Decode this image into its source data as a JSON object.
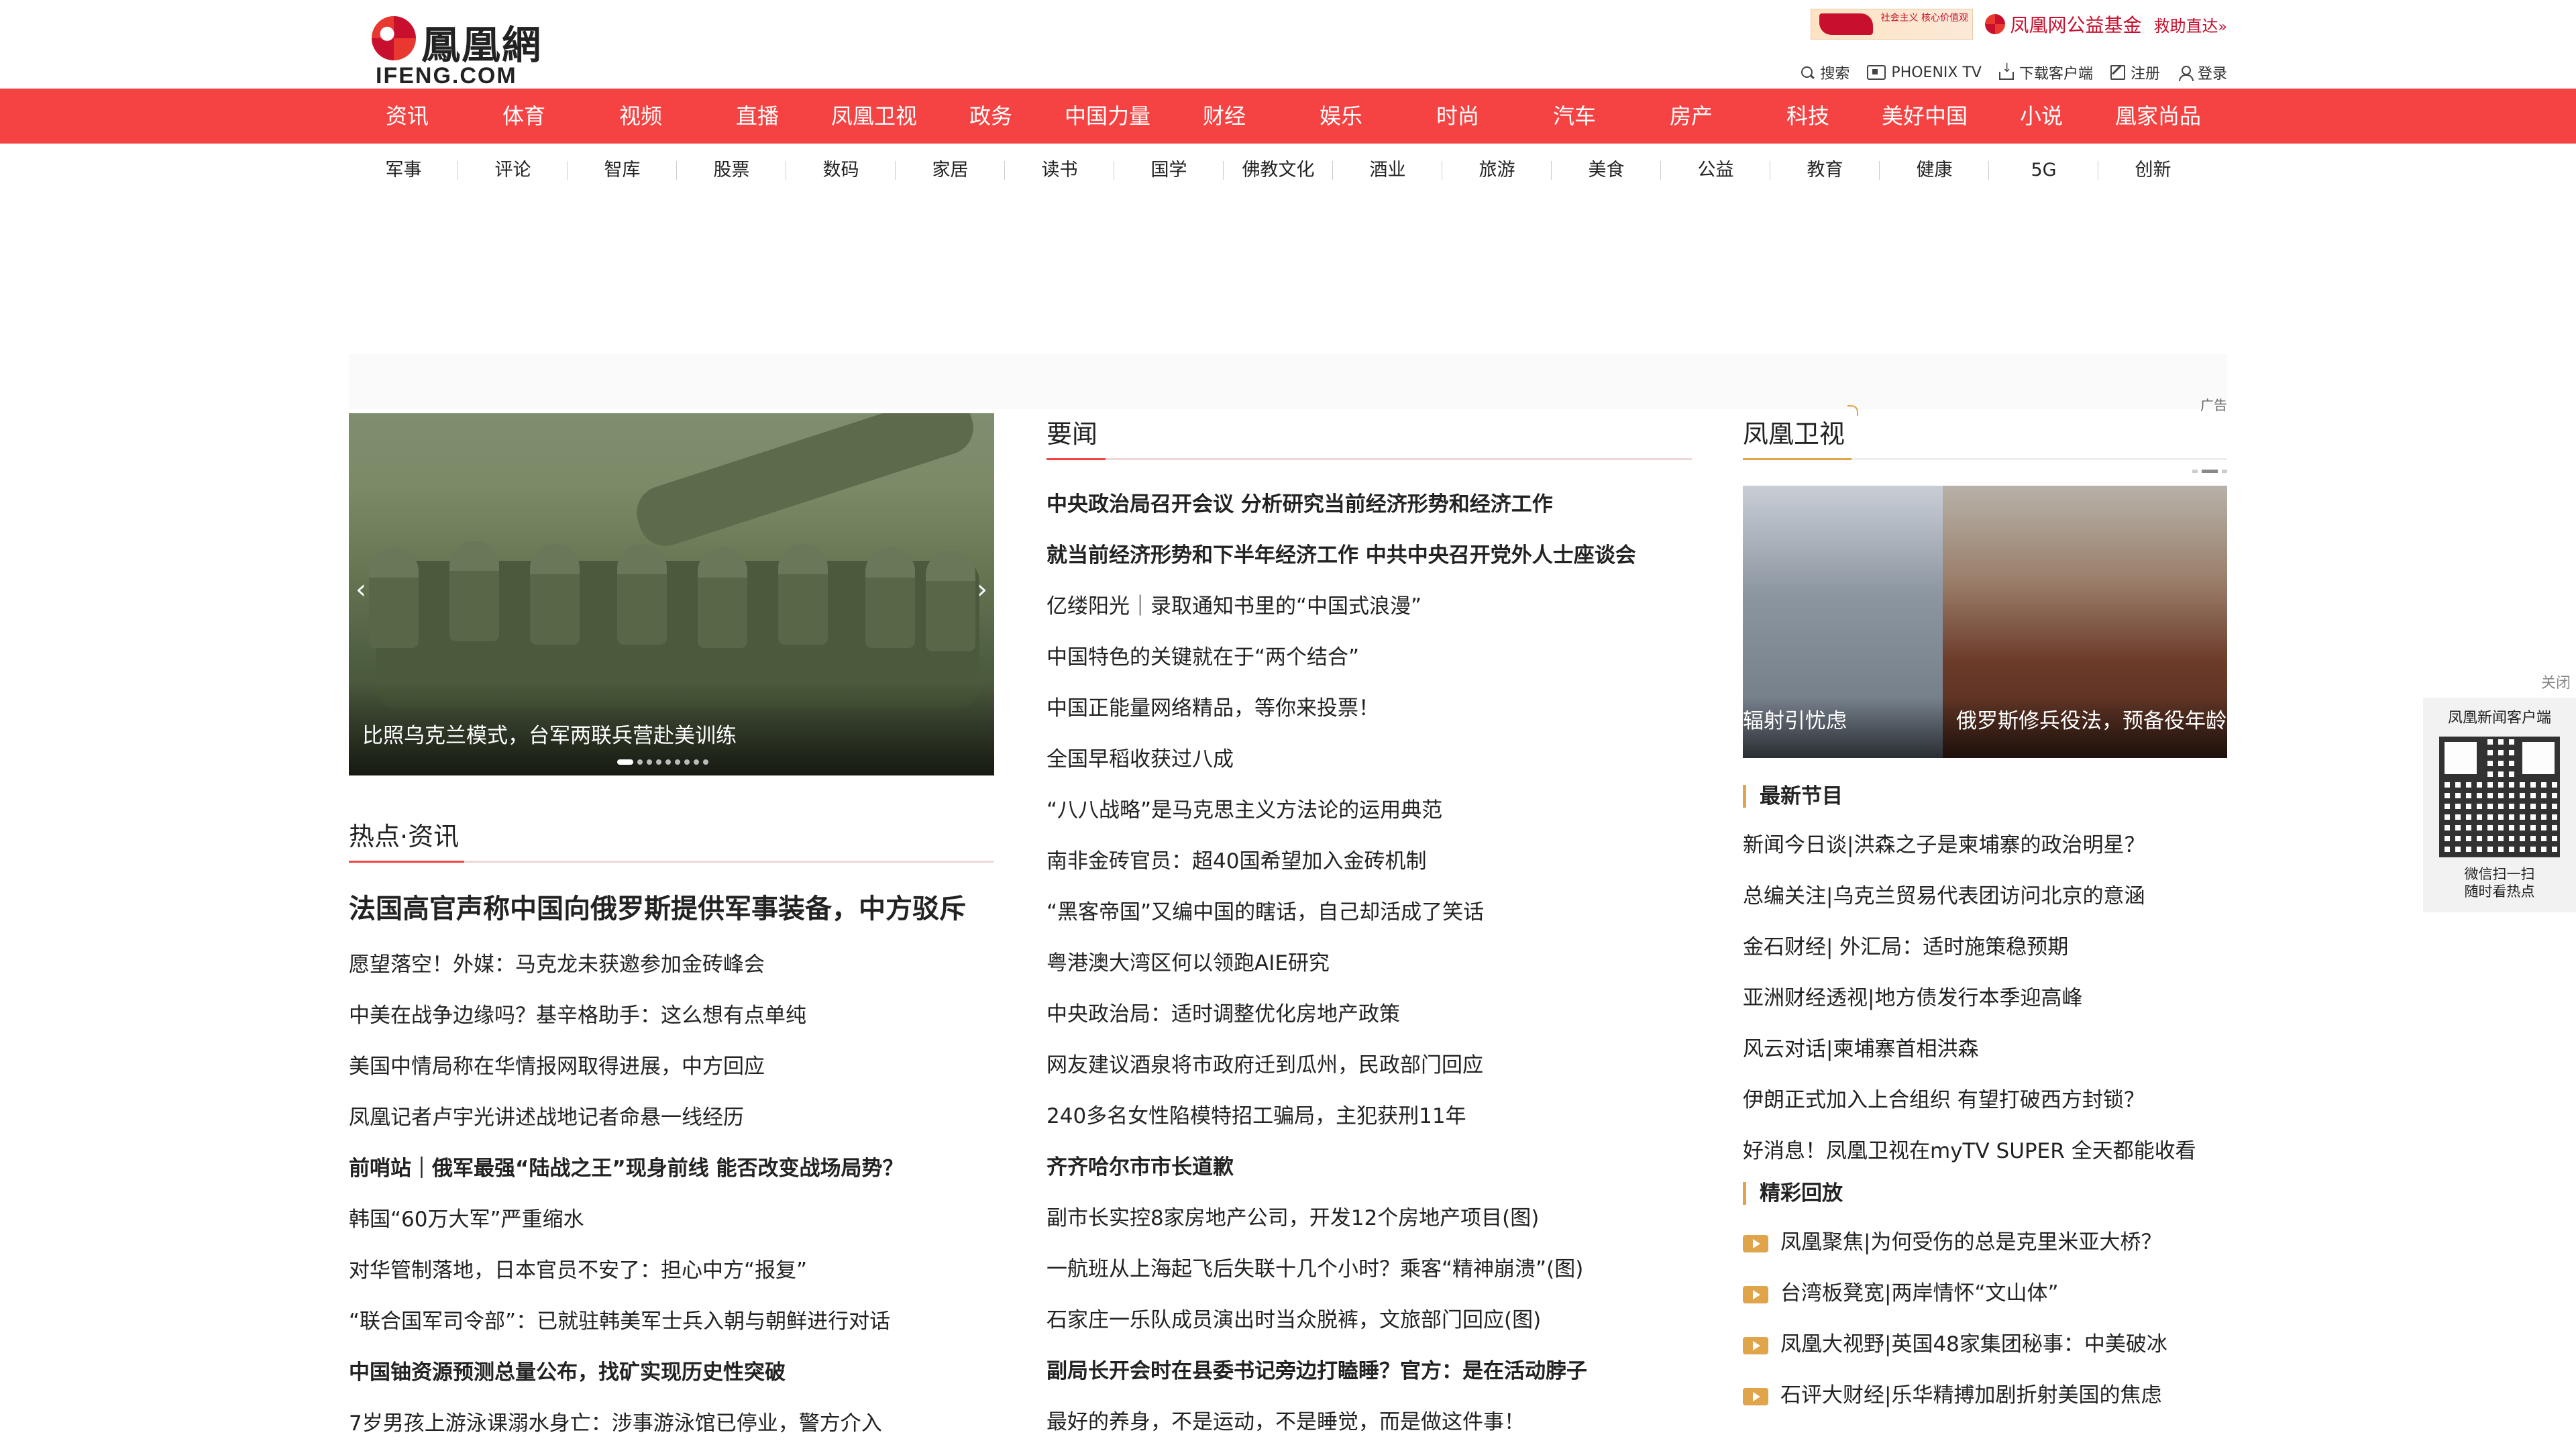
{
  "logo": {
    "cn": "鳳凰網",
    "en": "IFENG.COM"
  },
  "header": {
    "promo_text": "社会主义 核心价值观",
    "charity": "凤凰网公益基金",
    "rescue": "救助直达",
    "tools": [
      {
        "icon": "search-icon",
        "label": "搜索"
      },
      {
        "icon": "tv-icon",
        "label": "PHOENIX TV"
      },
      {
        "icon": "download-icon",
        "label": "下载客户端"
      },
      {
        "icon": "register-icon",
        "label": "注册"
      },
      {
        "icon": "user-icon",
        "label": "登录"
      }
    ]
  },
  "mainnav": [
    "资讯",
    "体育",
    "视频",
    "直播",
    "凤凰卫视",
    "政务",
    "中国力量",
    "财经",
    "娱乐",
    "时尚",
    "汽车",
    "房产",
    "科技",
    "美好中国",
    "小说",
    "凰家尚品"
  ],
  "subnav": [
    "军事",
    "评论",
    "智库",
    "股票",
    "数码",
    "家居",
    "读书",
    "国学",
    "佛教文化",
    "酒业",
    "旅游",
    "美食",
    "公益",
    "教育",
    "健康",
    "5G",
    "创新"
  ],
  "ad": {
    "label": "广告"
  },
  "slider": {
    "caption": "比照乌克兰模式，台军两联兵营赴美训练",
    "prev": "‹",
    "next": "›"
  },
  "hot": {
    "title": "热点·资讯",
    "lead": "法国高官声称中国向俄罗斯提供军事装备，中方驳斥",
    "items": [
      {
        "text": "愿望落空！外媒：马克龙未获邀参加金砖峰会",
        "bold": false
      },
      {
        "text": "中美在战争边缘吗？基辛格助手：这么想有点单纯",
        "bold": false
      },
      {
        "text": "美国中情局称在华情报网取得进展，中方回应",
        "bold": false
      },
      {
        "text": "凤凰记者卢宇光讲述战地记者命悬一线经历",
        "bold": false
      },
      {
        "text": "前哨站｜俄军最强“陆战之王”现身前线 能否改变战场局势？",
        "bold": true
      },
      {
        "text": "韩国“60万大军”严重缩水",
        "bold": false
      },
      {
        "text": "对华管制落地，日本官员不安了：担心中方“报复”",
        "bold": false
      },
      {
        "text": "“联合国军司令部”：已就驻韩美军士兵入朝与朝鲜进行对话",
        "bold": false
      },
      {
        "text": "中国铀资源预测总量公布，找矿实现历史性突破",
        "bold": true
      },
      {
        "text": "7岁男孩上游泳课溺水身亡：涉事游泳馆已停业，警方介入",
        "bold": false
      }
    ]
  },
  "yaowen": {
    "title": "要闻",
    "items": [
      {
        "text": "中央政治局召开会议 分析研究当前经济形势和经济工作",
        "bold": true
      },
      {
        "text": "就当前经济形势和下半年经济工作 中共中央召开党外人士座谈会",
        "bold": true
      },
      {
        "text": "亿缕阳光｜录取通知书里的“中国式浪漫”",
        "bold": false
      },
      {
        "text": "中国特色的关键就在于“两个结合”",
        "bold": false
      },
      {
        "text": "中国正能量网络精品，等你来投票！",
        "bold": false
      },
      {
        "text": "全国早稻收获过八成",
        "bold": false
      },
      {
        "text": "“八八战略”是马克思主义方法论的运用典范",
        "bold": false
      },
      {
        "text": "南非金砖官员：超40国希望加入金砖机制",
        "bold": false
      },
      {
        "text": "“黑客帝国”又编中国的瞎话，自己却活成了笑话",
        "bold": false
      },
      {
        "text": "粤港澳大湾区何以领跑AIE研究",
        "bold": false
      },
      {
        "text": "中央政治局：适时调整优化房地产政策",
        "bold": false
      },
      {
        "text": "网友建议酒泉将市政府迁到瓜州，民政部门回应",
        "bold": false
      },
      {
        "text": "240多名女性陷模特招工骗局，主犯获刑11年",
        "bold": false
      },
      {
        "text": "齐齐哈尔市市长道歉",
        "bold": true
      },
      {
        "text": "副市长实控8家房地产公司，开发12个房地产项目(图)",
        "bold": false
      },
      {
        "text": "一航班从上海起飞后失联十几个小时？乘客“精神崩溃”(图)",
        "bold": false
      },
      {
        "text": "石家庄一乐队成员演出时当众脱裤，文旅部门回应(图)",
        "bold": false
      },
      {
        "text": "副局长开会时在县委书记旁边打瞌睡？官方：是在活动脖子",
        "bold": true
      },
      {
        "text": "最好的养身，不是运动，不是睡觉，而是做这件事！",
        "bold": false
      }
    ]
  },
  "phoenixtv": {
    "title": "凤凰卫视",
    "cards": [
      {
        "caption": "辐射引忧虑"
      },
      {
        "caption": "俄罗斯修兵役法，预备役年龄"
      }
    ],
    "latest_title": "最新节目",
    "latest": [
      "新闻今日谈|洪森之子是柬埔寨的政治明星？",
      "总编关注|乌克兰贸易代表团访问北京的意涵",
      "金石财经| 外汇局：适时施策稳预期",
      "亚洲财经透视|地方债发行本季迎高峰",
      "风云对话|柬埔寨首相洪森",
      "伊朗正式加入上合组织 有望打破西方封锁？",
      "好消息！凤凰卫视在myTV SUPER 全天都能收看"
    ],
    "replay_title": "精彩回放",
    "replay": [
      "凤凰聚焦|为何受伤的总是克里米亚大桥？",
      "台湾板凳宽|两岸情怀“文山体”",
      "凤凰大视野|英国48家集团秘事：中美破冰",
      "石评大财经|乐华精搏加剧折射美国的焦虑"
    ]
  },
  "qr": {
    "close": "关闭",
    "title": "凤凰新闻客户端",
    "line1": "微信扫一扫",
    "line2": "随时看热点"
  }
}
